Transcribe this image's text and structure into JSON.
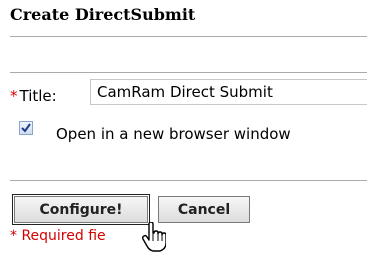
{
  "page": {
    "title": "Create DirectSubmit"
  },
  "form": {
    "required_marker": "*",
    "title_label": "Title:",
    "title_value": "CamRam Direct Submit",
    "open_new_window_label": "Open in a new browser window",
    "open_new_window_checked": true
  },
  "buttons": {
    "configure_label": "Configure!",
    "cancel_label": "Cancel"
  },
  "footer": {
    "required_note": "* Required fie"
  },
  "colors": {
    "required": "#d40000",
    "rule": "#aaaaaa"
  },
  "cursor": {
    "icon": "hand-pointer-icon"
  }
}
